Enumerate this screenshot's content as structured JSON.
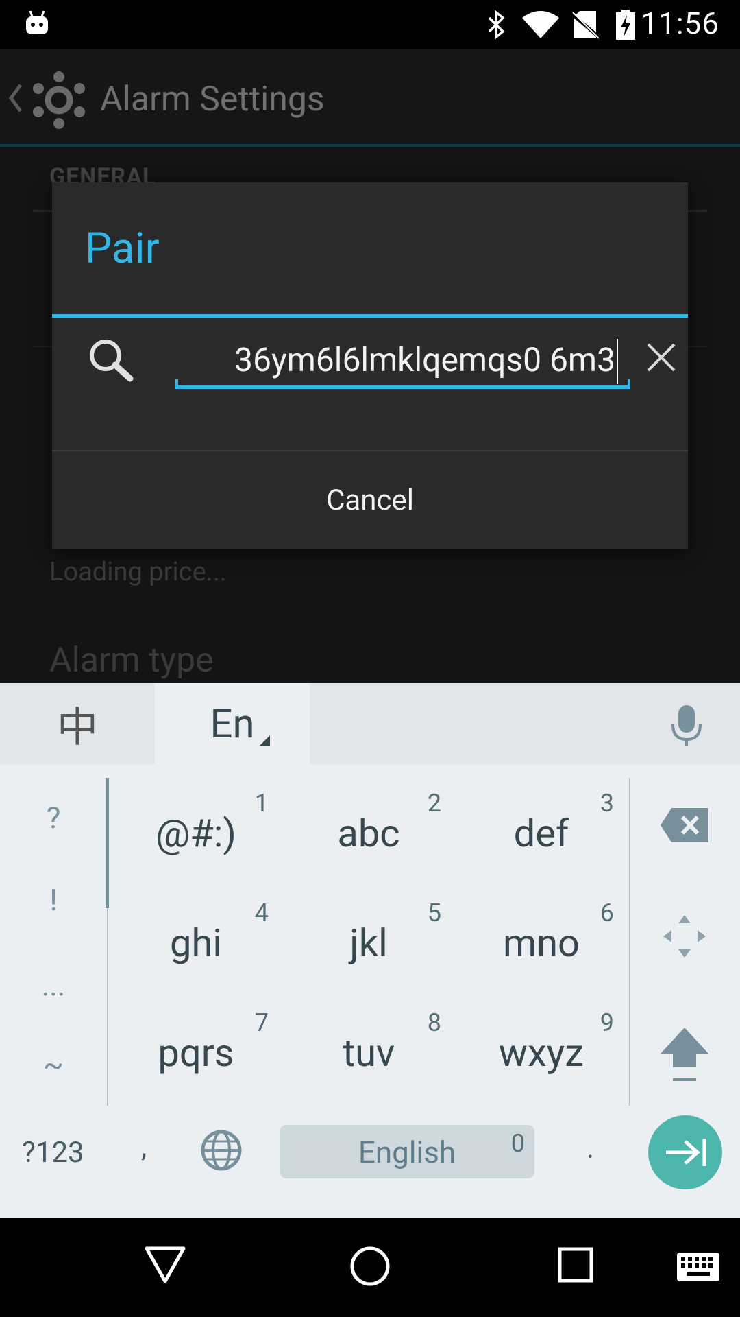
{
  "status_bar": {
    "time": "11:56",
    "icons": [
      "android-notification-icon",
      "bluetooth-icon",
      "wifi-icon",
      "no-sim-icon",
      "battery-charging-icon"
    ]
  },
  "app": {
    "title": "Alarm Settings",
    "section_header": "GENERAL",
    "loading_text": "Loading price...",
    "alarm_type_label": "Alarm type"
  },
  "dialog": {
    "title": "Pair",
    "search_value": "36ym6l6lmklqemqs0 6m3",
    "cancel_label": "Cancel"
  },
  "keyboard": {
    "lang_chinese": "中",
    "lang_english": "En",
    "symbols": [
      "?",
      "!",
      "...",
      "~"
    ],
    "keys": [
      {
        "label": "@#:)",
        "num": "1"
      },
      {
        "label": "abc",
        "num": "2"
      },
      {
        "label": "def",
        "num": "3"
      },
      {
        "label": "ghi",
        "num": "4"
      },
      {
        "label": "jkl",
        "num": "5"
      },
      {
        "label": "mno",
        "num": "6"
      },
      {
        "label": "pqrs",
        "num": "7"
      },
      {
        "label": "tuv",
        "num": "8"
      },
      {
        "label": "wxyz",
        "num": "9"
      }
    ],
    "bottom": {
      "num_switch": "?123",
      "comma": ",",
      "space_label": "English",
      "space_num": "0",
      "period": "."
    }
  },
  "colors": {
    "accent": "#33b5e5",
    "enter_key": "#4db6ac",
    "keyboard_bg": "#eceff1"
  }
}
